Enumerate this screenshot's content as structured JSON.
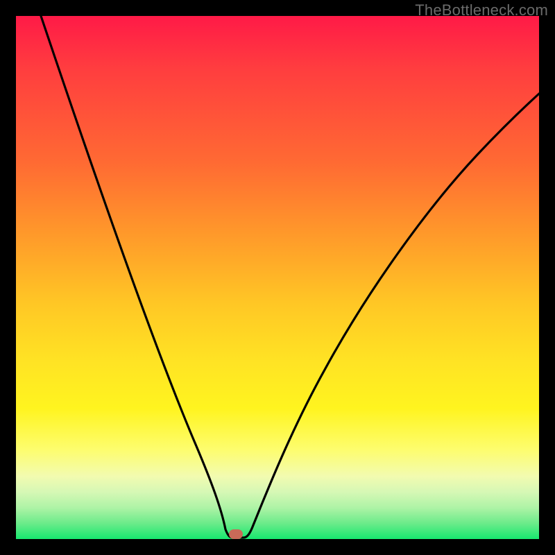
{
  "watermark": "TheBottleneck.com",
  "colors": {
    "frame": "#000000",
    "curve": "#000000",
    "marker": "#c86a58",
    "gradient_stops": [
      "#ff1a47",
      "#ff6a33",
      "#ffc725",
      "#fff41f",
      "#d6f8b5",
      "#17e86f"
    ]
  },
  "chart_data": {
    "type": "line",
    "title": "",
    "xlabel": "",
    "ylabel": "",
    "xlim": [
      0,
      100
    ],
    "ylim": [
      0,
      100
    ],
    "x": [
      0,
      5,
      10,
      15,
      20,
      25,
      30,
      35,
      38,
      40,
      42,
      44,
      50,
      55,
      60,
      65,
      70,
      75,
      80,
      85,
      90,
      95,
      100
    ],
    "values": [
      100,
      88,
      76,
      64,
      53,
      42,
      31,
      18,
      7,
      0,
      0,
      5,
      20,
      32,
      42,
      50,
      58,
      64,
      70,
      75,
      79,
      82,
      85
    ],
    "marker": {
      "x": 41,
      "y": 0
    },
    "grid": false,
    "legend": false
  }
}
